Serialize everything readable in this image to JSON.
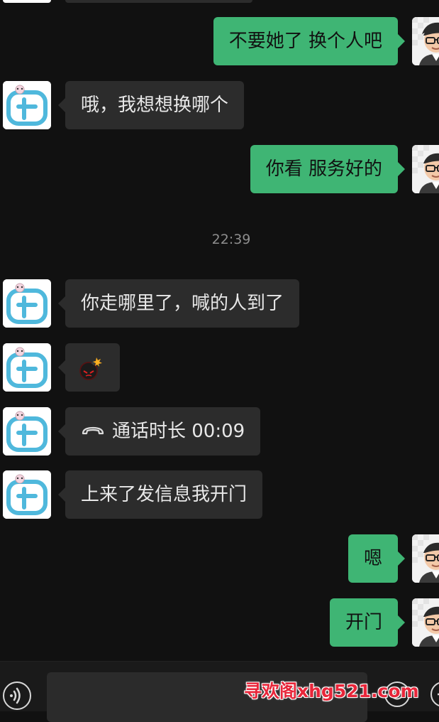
{
  "messages": [
    {
      "sender": "me",
      "text": "不要她了 换个人吧"
    },
    {
      "sender": "other",
      "text": "哦，我想想换哪个"
    },
    {
      "sender": "me",
      "text": "你看 服务好的"
    },
    {
      "sender": "other",
      "text": "你走哪里了，喊的人到了"
    },
    {
      "sender": "other",
      "type": "emoji",
      "icon": "bomb-emoji"
    },
    {
      "sender": "other",
      "type": "call",
      "icon": "phone-icon",
      "text": "通话时长 00:09"
    },
    {
      "sender": "other",
      "text": "上来了发信息我开门"
    },
    {
      "sender": "me",
      "text": "嗯"
    },
    {
      "sender": "me",
      "text": "开门"
    }
  ],
  "timestamp": "22:39",
  "toolbar": {
    "voice_icon": "voice-icon",
    "emoji_icon": "emoji-icon",
    "plus_icon": "plus-icon"
  },
  "watermark": "寻欢阁xhg521.com",
  "colors": {
    "background": "#111111",
    "bubble_me": "#3fb574",
    "bubble_other": "#2c2c2c",
    "watermark": "#e8263a"
  }
}
